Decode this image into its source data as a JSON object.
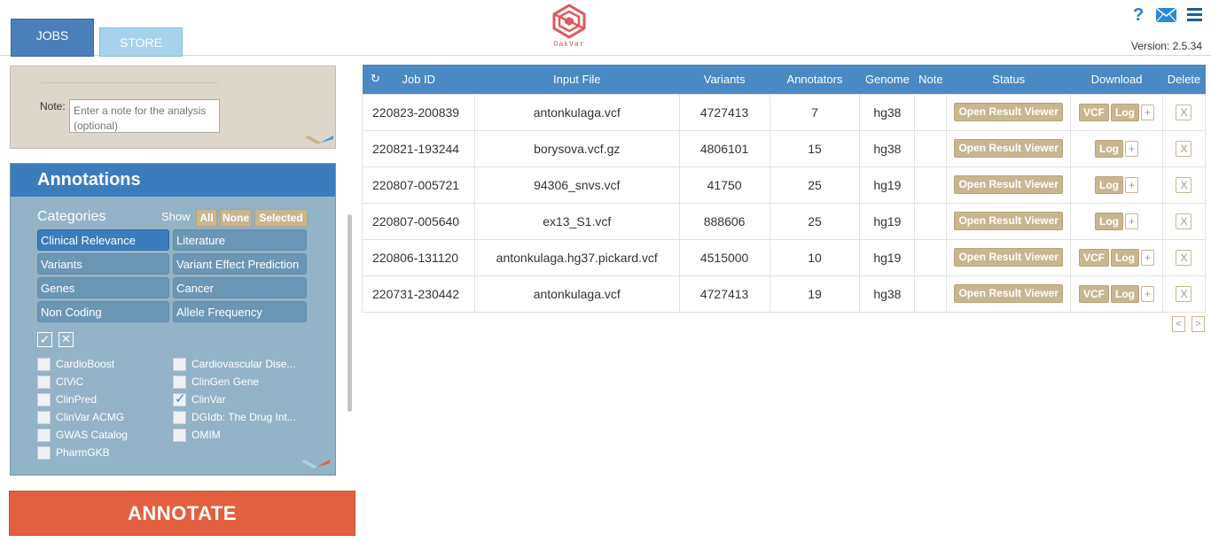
{
  "header": {
    "tabs": [
      {
        "label": "JOBS"
      },
      {
        "label": "STORE"
      }
    ],
    "logo_text": "OakVar",
    "help_glyph": "?",
    "version": "Version: 2.5.34",
    "icons": [
      "help-icon",
      "mail-icon",
      "hamburger-menu-icon"
    ]
  },
  "note": {
    "label": "Note:",
    "placeholder": "Enter a note for the analysis (optional)"
  },
  "annotations": {
    "title": "Annotations",
    "categories_label": "Categories",
    "show_label": "Show",
    "show_buttons": [
      "All",
      "None",
      "Selected"
    ],
    "categories": [
      {
        "label": "Clinical Relevance",
        "active": true
      },
      {
        "label": "Literature",
        "active": false
      },
      {
        "label": "Variants",
        "active": false
      },
      {
        "label": "Variant Effect Prediction",
        "active": false
      },
      {
        "label": "Genes",
        "active": false
      },
      {
        "label": "Cancer",
        "active": false
      },
      {
        "label": "Non Coding",
        "active": false
      },
      {
        "label": "Allele Frequency",
        "active": false
      }
    ],
    "check_all_glyph": "✓",
    "uncheck_all_glyph": "✕",
    "items": [
      {
        "label": "CardioBoost",
        "checked": false
      },
      {
        "label": "Cardiovascular Dise...",
        "checked": false
      },
      {
        "label": "CIViC",
        "checked": false
      },
      {
        "label": "ClinGen Gene",
        "checked": false
      },
      {
        "label": "ClinPred",
        "checked": false
      },
      {
        "label": "ClinVar",
        "checked": true
      },
      {
        "label": "ClinVar ACMG",
        "checked": false
      },
      {
        "label": "DGIdb: The Drug Int...",
        "checked": false
      },
      {
        "label": "GWAS Catalog",
        "checked": false
      },
      {
        "label": "OMIM",
        "checked": false
      },
      {
        "label": "PharmGKB",
        "checked": false
      }
    ]
  },
  "annotate_button": "ANNOTATE",
  "jobs": {
    "refresh_glyph": "↻",
    "columns": [
      "Job ID",
      "Input File",
      "Variants",
      "Annotators",
      "Genome",
      "Note",
      "Status",
      "Download",
      "Delete"
    ],
    "status_button": "Open Result Viewer",
    "vcf_label": "VCF",
    "log_label": "Log",
    "plus_label": "+",
    "delete_label": "X",
    "rows": [
      {
        "job_id": "220823-200839",
        "input_file": "antonkulaga.vcf",
        "variants": "4727413",
        "annotators": "7",
        "genome": "hg38",
        "note": "",
        "has_vcf": true
      },
      {
        "job_id": "220821-193244",
        "input_file": "borysova.vcf.gz",
        "variants": "4806101",
        "annotators": "15",
        "genome": "hg38",
        "note": "",
        "has_vcf": false
      },
      {
        "job_id": "220807-005721",
        "input_file": "94306_snvs.vcf",
        "variants": "41750",
        "annotators": "25",
        "genome": "hg19",
        "note": "",
        "has_vcf": false
      },
      {
        "job_id": "220807-005640",
        "input_file": "ex13_S1.vcf",
        "variants": "888606",
        "annotators": "25",
        "genome": "hg19",
        "note": "",
        "has_vcf": false
      },
      {
        "job_id": "220806-131120",
        "input_file": "antonkulaga.hg37.pickard.vcf",
        "variants": "4515000",
        "annotators": "10",
        "genome": "hg19",
        "note": "",
        "has_vcf": true
      },
      {
        "job_id": "220731-230442",
        "input_file": "antonkulaga.vcf",
        "variants": "4727413",
        "annotators": "19",
        "genome": "hg38",
        "note": "",
        "has_vcf": true
      }
    ],
    "pager_prev": "<",
    "pager_next": ">"
  }
}
